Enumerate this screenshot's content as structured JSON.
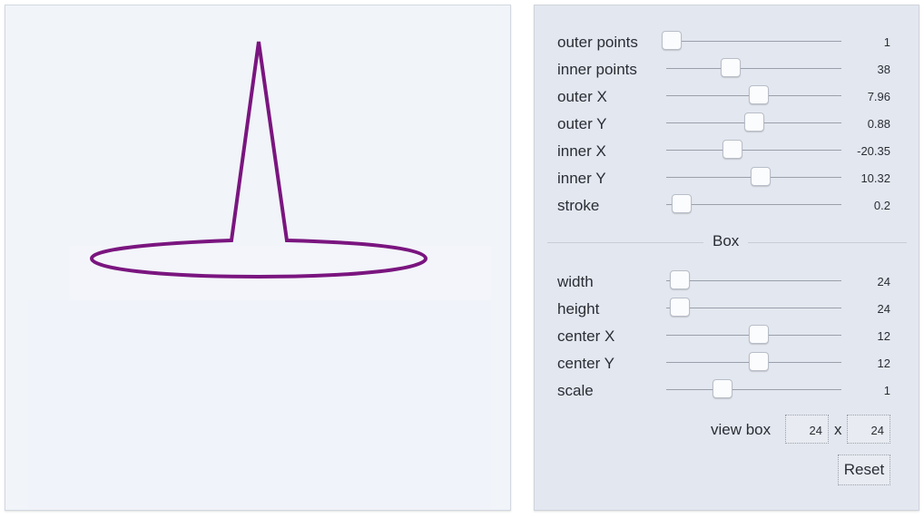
{
  "colors": {
    "shape_stroke": "#7a157f"
  },
  "star_controls": [
    {
      "label": "outer points",
      "value": "1",
      "fraction": 0.03
    },
    {
      "label": "inner points",
      "value": "38",
      "fraction": 0.37
    },
    {
      "label": "outer X",
      "value": "7.96",
      "fraction": 0.53
    },
    {
      "label": "outer Y",
      "value": "0.88",
      "fraction": 0.5
    },
    {
      "label": "inner X",
      "value": "-20.35",
      "fraction": 0.38
    },
    {
      "label": "inner Y",
      "value": "10.32",
      "fraction": 0.54
    },
    {
      "label": "stroke",
      "value": "0.2",
      "fraction": 0.09
    }
  ],
  "box_section_label": "Box",
  "box_controls": [
    {
      "label": "width",
      "value": "24",
      "fraction": 0.08
    },
    {
      "label": "height",
      "value": "24",
      "fraction": 0.08
    },
    {
      "label": "center X",
      "value": "12",
      "fraction": 0.53
    },
    {
      "label": "center Y",
      "value": "12",
      "fraction": 0.53
    },
    {
      "label": "scale",
      "value": "1",
      "fraction": 0.32
    }
  ],
  "view_box": {
    "label": "view box",
    "width": "24",
    "separator": "x",
    "height": "24"
  },
  "reset_label": "Reset"
}
